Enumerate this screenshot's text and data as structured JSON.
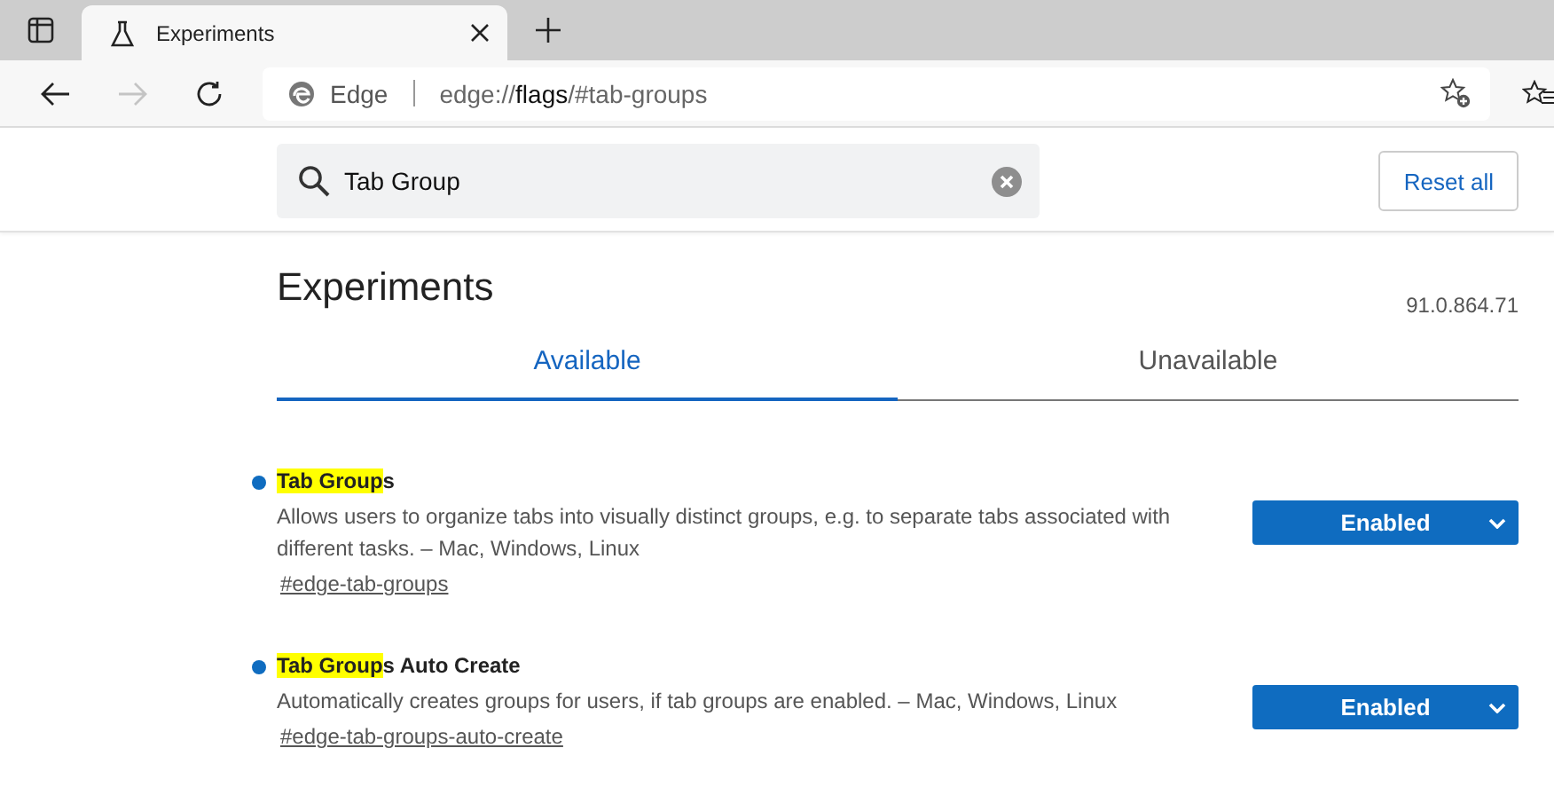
{
  "browser_tab": {
    "title": "Experiments",
    "selected": true
  },
  "address_bar": {
    "site_label": "Edge",
    "url_scheme": "edge://",
    "url_host": "flags",
    "url_rest": "/#tab-groups"
  },
  "search": {
    "value": "Tab Group"
  },
  "reset_button": "Reset all",
  "page_title": "Experiments",
  "version": "91.0.864.71",
  "tabs": [
    {
      "label": "Available",
      "selected": true
    },
    {
      "label": "Unavailable",
      "selected": false
    }
  ],
  "flags": [
    {
      "title_match": "Tab Group",
      "title_rest": "s",
      "modified": true,
      "description": "Allows users to organize tabs into visually distinct groups, e.g. to separate tabs associated with different tasks. – Mac, Windows, Linux",
      "link": "#edge-tab-groups",
      "value": "Enabled"
    },
    {
      "title_match": "Tab Group",
      "title_rest": "s Auto Create",
      "modified": true,
      "description": "Automatically creates groups for users, if tab groups are enabled. – Mac, Windows, Linux",
      "link": "#edge-tab-groups-auto-create",
      "value": "Enabled"
    }
  ]
}
